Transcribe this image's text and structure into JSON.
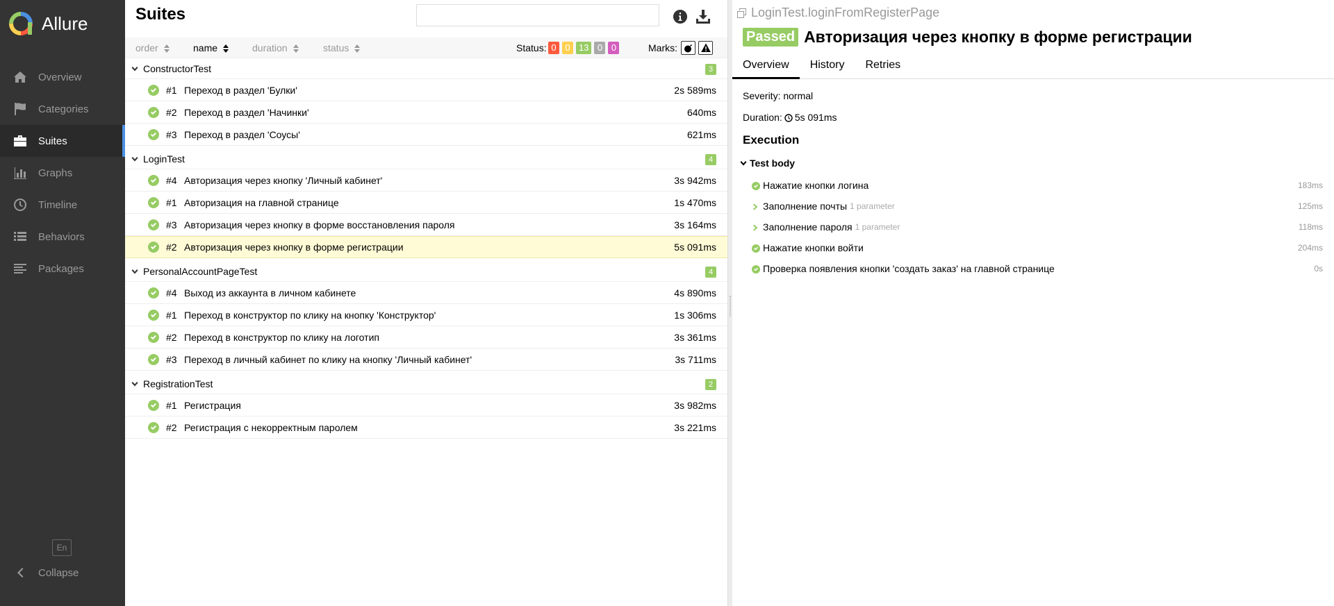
{
  "brand": {
    "name": "Allure"
  },
  "nav": {
    "items": [
      {
        "label": "Overview",
        "icon": "home-icon"
      },
      {
        "label": "Categories",
        "icon": "flag-icon"
      },
      {
        "label": "Suites",
        "icon": "briefcase-icon",
        "active": true
      },
      {
        "label": "Graphs",
        "icon": "bar-chart-icon"
      },
      {
        "label": "Timeline",
        "icon": "clock-icon"
      },
      {
        "label": "Behaviors",
        "icon": "list-icon"
      },
      {
        "label": "Packages",
        "icon": "align-left-icon"
      }
    ],
    "lang": "En",
    "collapse": "Collapse"
  },
  "suites": {
    "title": "Suites",
    "search": {
      "value": "",
      "placeholder": ""
    },
    "sort": {
      "order": "order",
      "name": "name",
      "duration": "duration",
      "status": "status"
    },
    "status_label": "Status:",
    "status_counts": [
      {
        "value": "0",
        "color": "#fd5a3e"
      },
      {
        "value": "0",
        "color": "#ffd050"
      },
      {
        "value": "13",
        "color": "#97cc64"
      },
      {
        "value": "0",
        "color": "#aaaaaa"
      },
      {
        "value": "0",
        "color": "#d35ebe"
      }
    ],
    "marks_label": "Marks:",
    "groups": [
      {
        "name": "ConstructorTest",
        "count": "3",
        "tests": [
          {
            "num": "#1",
            "name": "Переход в раздел 'Булки'",
            "duration": "2s 589ms"
          },
          {
            "num": "#2",
            "name": "Переход в раздел 'Начинки'",
            "duration": "640ms"
          },
          {
            "num": "#3",
            "name": "Переход в раздел 'Соусы'",
            "duration": "621ms"
          }
        ]
      },
      {
        "name": "LoginTest",
        "count": "4",
        "tests": [
          {
            "num": "#4",
            "name": "Авторизация через кнопку 'Личный кабинет'",
            "duration": "3s 942ms"
          },
          {
            "num": "#1",
            "name": "Авторизация на главной странице",
            "duration": "1s 470ms"
          },
          {
            "num": "#3",
            "name": "Авторизация через кнопку в форме восстановления пароля",
            "duration": "3s 164ms"
          },
          {
            "num": "#2",
            "name": "Авторизация через кнопку в форме регистрации",
            "duration": "5s 091ms",
            "selected": true
          }
        ]
      },
      {
        "name": "PersonalAccountPageTest",
        "count": "4",
        "tests": [
          {
            "num": "#4",
            "name": "Выход из аккаунта в личном кабинете",
            "duration": "4s 890ms"
          },
          {
            "num": "#1",
            "name": "Переход в конструктор по клику на кнопку 'Конструктор'",
            "duration": "1s 306ms"
          },
          {
            "num": "#2",
            "name": "Переход в конструктор по клику на логотип",
            "duration": "3s 361ms"
          },
          {
            "num": "#3",
            "name": "Переход в личный кабинет по клику на кнопку 'Личный кабинет'",
            "duration": "3s 711ms"
          }
        ]
      },
      {
        "name": "RegistrationTest",
        "count": "2",
        "tests": [
          {
            "num": "#1",
            "name": "Регистрация",
            "duration": "3s 982ms"
          },
          {
            "num": "#2",
            "name": "Регистрация с некорректным паролем",
            "duration": "3s 221ms"
          }
        ]
      }
    ]
  },
  "detail": {
    "path": "LoginTest.loginFromRegisterPage",
    "status": "Passed",
    "title": "Авторизация через кнопку в форме регистрации",
    "tabs": [
      "Overview",
      "History",
      "Retries"
    ],
    "severity": "Severity: normal",
    "duration_label": "Duration:",
    "duration_value": "5s 091ms",
    "execution": "Execution",
    "test_body": "Test body",
    "steps": [
      {
        "name": "Нажатие кнопки логина",
        "param": "",
        "duration": "183ms",
        "expandable": false
      },
      {
        "name": "Заполнение почты",
        "param": "1 parameter",
        "duration": "125ms",
        "expandable": true
      },
      {
        "name": "Заполнение пароля",
        "param": "1 parameter",
        "duration": "118ms",
        "expandable": true
      },
      {
        "name": "Нажатие кнопки войти",
        "param": "",
        "duration": "204ms",
        "expandable": false
      },
      {
        "name": "Проверка появления кнопки 'создать заказ' на главной странице",
        "param": "",
        "duration": "0s",
        "expandable": false
      }
    ]
  },
  "colors": {
    "passed": "#97cc64",
    "sidebar": "#343434",
    "accent": "#4a90e2",
    "selected_row": "#fffbd6"
  }
}
